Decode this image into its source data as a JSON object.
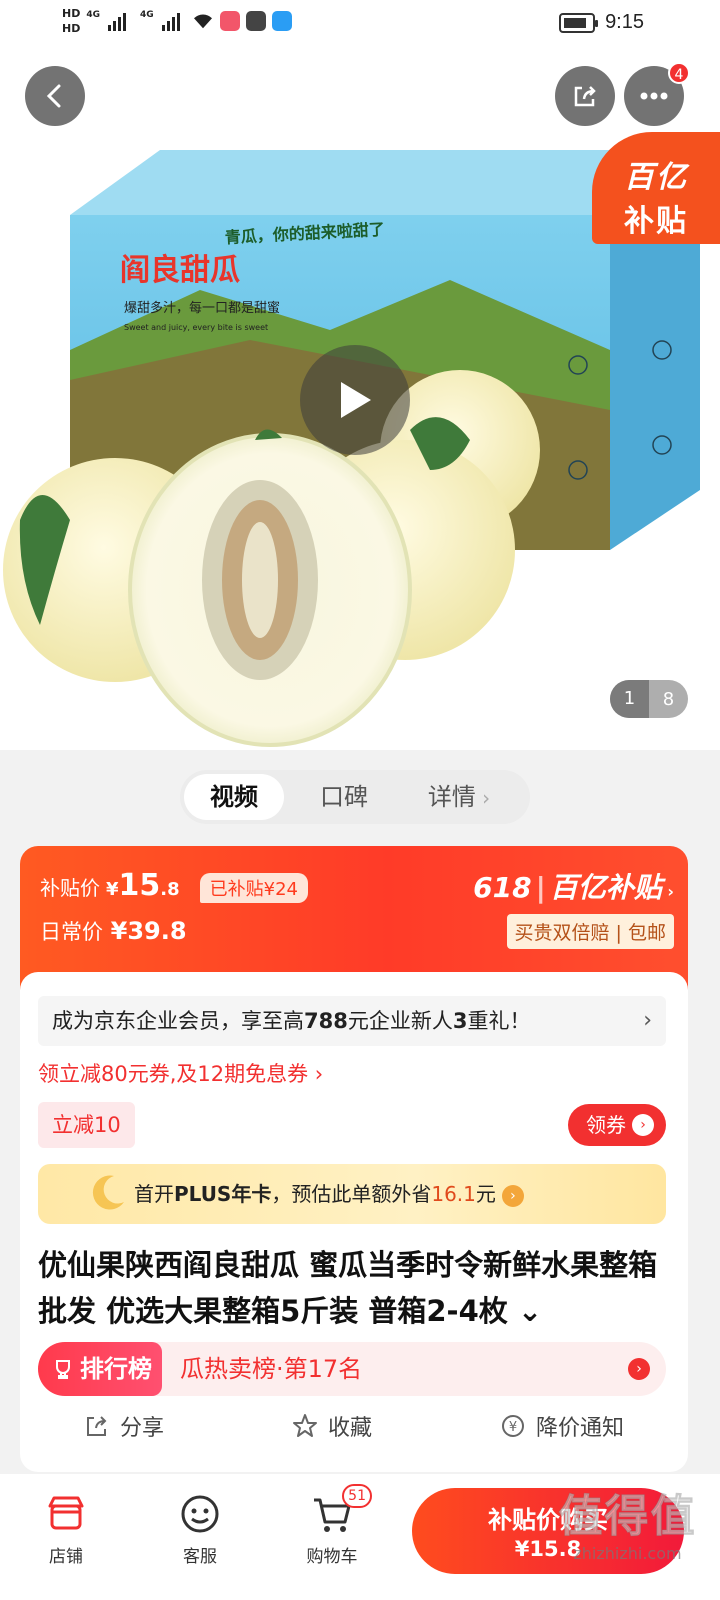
{
  "status_bar": {
    "hd1": "HD",
    "hd2": "HD",
    "sig1": "4G",
    "sig2": "4G",
    "time": "9:15"
  },
  "hero": {
    "notification_count": "4",
    "corner_line1": "百亿",
    "corner_line2": "补贴",
    "box_title": "阎良甜瓜",
    "box_slogan": "爆甜多汁，每一口都是甜蜜",
    "box_english": "Sweet and juicy, every bite is sweet",
    "box_top_text": "青瓜，你的甜来啦甜了",
    "page_current": "1",
    "page_total": "8"
  },
  "tabs": [
    {
      "label": "视频",
      "active": true
    },
    {
      "label": "口碑",
      "active": false
    },
    {
      "label": "详情",
      "active": false
    }
  ],
  "price": {
    "subsidy_label": "补贴价",
    "subsidy_currency": "¥",
    "subsidy_integer": "15",
    "subsidy_decimal": ".8",
    "subsidized_tag": "已补贴¥24",
    "daily_label": "日常价",
    "daily_price": "¥39.8",
    "brand_618": "618",
    "brand_name": "百亿补贴",
    "guarantee_tag": "买贵双倍赔 | 包邮"
  },
  "detail": {
    "member_banner_a": "成为京东企业会员，享至高",
    "member_banner_b": "788",
    "member_banner_c": "元企业新人",
    "member_banner_d": "3",
    "member_banner_e": "重礼！",
    "coupon_line": "领立减80元券,及12期免息券 ›",
    "reduce_tag": "立减10",
    "get_coupon_label": "领券",
    "plus_a": "首开",
    "plus_b": "PLUS年卡",
    "plus_c": "，预估此单额外省",
    "plus_d": "16.1",
    "plus_e": "元",
    "title": "优仙果陕西阎良甜瓜 蜜瓜当季时令新鲜水果整箱批发 优选大果整箱5斤装 普箱2-4枚 ⌄",
    "rank_tag": "排行榜",
    "rank_text": "瓜热卖榜·第17名",
    "actions": [
      "分享",
      "收藏",
      "降价通知"
    ]
  },
  "bottom_nav": {
    "shop": "店铺",
    "service": "客服",
    "cart": "购物车",
    "cart_count": "51",
    "buy_line1": "补贴价购买",
    "buy_line2": "¥15.8"
  },
  "watermark": {
    "logo": "值得值",
    "url": "zhizhizhi.com"
  },
  "colors": {
    "accent_red": "#f23030",
    "subsidy_orange": "#f4511e"
  }
}
